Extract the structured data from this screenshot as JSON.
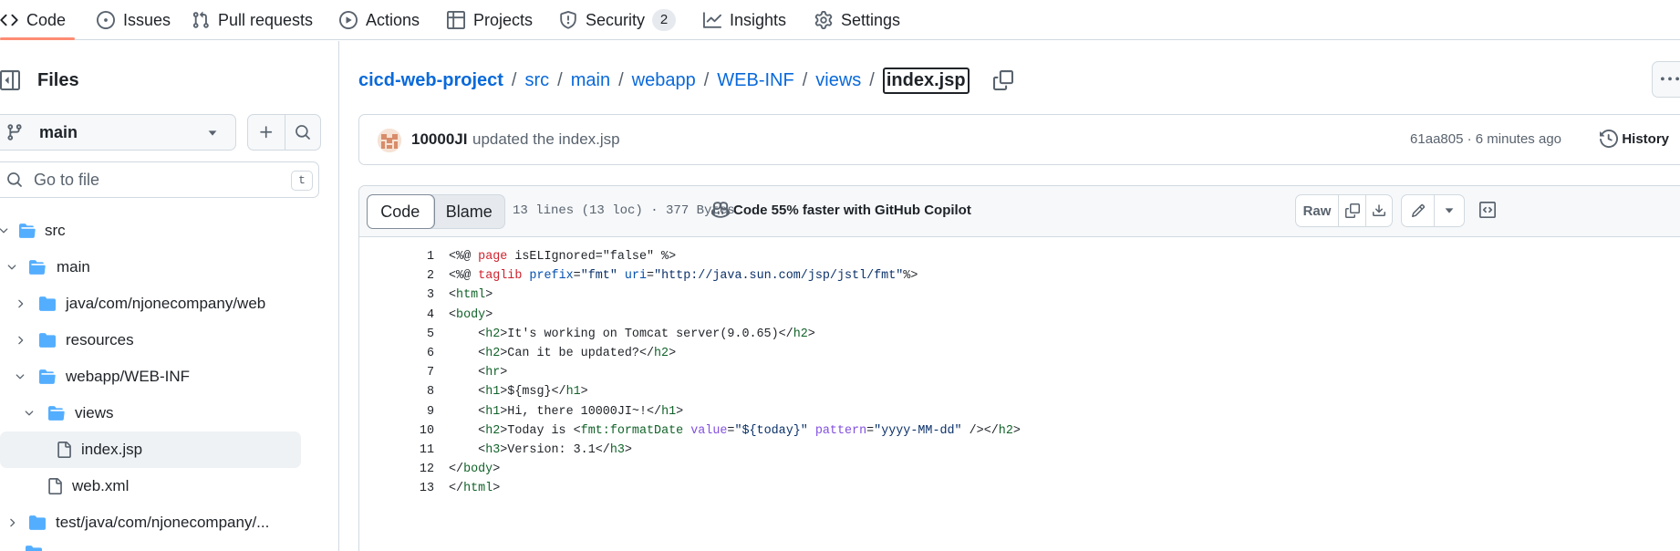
{
  "nav": {
    "tabs": [
      {
        "label": "Code"
      },
      {
        "label": "Issues"
      },
      {
        "label": "Pull requests"
      },
      {
        "label": "Actions"
      },
      {
        "label": "Projects"
      },
      {
        "label": "Security",
        "count": "2"
      },
      {
        "label": "Insights"
      },
      {
        "label": "Settings"
      }
    ]
  },
  "sidebar": {
    "title": "Files",
    "branch": "main",
    "search_placeholder": "Go to file",
    "search_shortcut": "t",
    "tree": [
      {
        "label": "src",
        "type": "folder",
        "expanded": true
      },
      {
        "label": "main",
        "type": "folder",
        "expanded": true
      },
      {
        "label": "java/com/njonecompany/web",
        "type": "folder",
        "expanded": false
      },
      {
        "label": "resources",
        "type": "folder",
        "expanded": false
      },
      {
        "label": "webapp/WEB-INF",
        "type": "folder",
        "expanded": true
      },
      {
        "label": "views",
        "type": "folder",
        "expanded": true
      },
      {
        "label": "index.jsp",
        "type": "file",
        "selected": true
      },
      {
        "label": "web.xml",
        "type": "file"
      },
      {
        "label": "test/java/com/njonecompany/...",
        "type": "folder",
        "expanded": false
      }
    ]
  },
  "breadcrumb": {
    "repo": "cicd-web-project",
    "parts": [
      "src",
      "main",
      "webapp",
      "WEB-INF",
      "views"
    ],
    "separator": "/",
    "current": "index.jsp"
  },
  "commit": {
    "author": "10000JI",
    "message": "updated the index.jsp",
    "meta": "61aa805 · 6 minutes ago",
    "history_label": "History"
  },
  "codeview": {
    "tab_code": "Code",
    "tab_blame": "Blame",
    "file_info": "13 lines (13 loc) · 377 Bytes",
    "copilot_text": "Code 55% faster with GitHub Copilot",
    "raw_label": "Raw",
    "line_numbers": [
      "1",
      "2",
      "3",
      "4",
      "5",
      "6",
      "7",
      "8",
      "9",
      "10",
      "11",
      "12",
      "13"
    ],
    "code": [
      [
        [
          "<%@ ",
          "p"
        ],
        [
          "page",
          "k"
        ],
        [
          " isELIgnored=\"false\" %>",
          "p"
        ]
      ],
      [
        [
          "<%@ ",
          "p"
        ],
        [
          "taglib",
          "k"
        ],
        [
          " ",
          "p"
        ],
        [
          "prefix",
          "a"
        ],
        [
          "=",
          "p"
        ],
        [
          "\"fmt\"",
          "s"
        ],
        [
          " ",
          "p"
        ],
        [
          "uri",
          "a"
        ],
        [
          "=",
          "p"
        ],
        [
          "\"http://java.sun.com/jsp/jstl/fmt\"",
          "s"
        ],
        [
          "%>",
          "p"
        ]
      ],
      [
        [
          "<",
          "p"
        ],
        [
          "html",
          "t"
        ],
        [
          ">",
          "p"
        ]
      ],
      [
        [
          "<",
          "p"
        ],
        [
          "body",
          "t"
        ],
        [
          ">",
          "p"
        ]
      ],
      [
        [
          "    <",
          "p"
        ],
        [
          "h2",
          "t"
        ],
        [
          ">It's working on Tomcat server(9.0.65)</",
          "p"
        ],
        [
          "h2",
          "t"
        ],
        [
          ">",
          "p"
        ]
      ],
      [
        [
          "    <",
          "p"
        ],
        [
          "h2",
          "t"
        ],
        [
          ">Can it be updated?</",
          "p"
        ],
        [
          "h2",
          "t"
        ],
        [
          ">",
          "p"
        ]
      ],
      [
        [
          "    <",
          "p"
        ],
        [
          "hr",
          "t"
        ],
        [
          ">",
          "p"
        ]
      ],
      [
        [
          "    <",
          "p"
        ],
        [
          "h1",
          "t"
        ],
        [
          ">${msg}</",
          "p"
        ],
        [
          "h1",
          "t"
        ],
        [
          ">",
          "p"
        ]
      ],
      [
        [
          "    <",
          "p"
        ],
        [
          "h1",
          "t"
        ],
        [
          ">Hi, there 10000JI~!</",
          "p"
        ],
        [
          "h1",
          "t"
        ],
        [
          ">",
          "p"
        ]
      ],
      [
        [
          "    <",
          "p"
        ],
        [
          "h2",
          "t"
        ],
        [
          ">Today is <",
          "p"
        ],
        [
          "fmt:formatDate",
          "t"
        ],
        [
          " ",
          "p"
        ],
        [
          "value",
          "at"
        ],
        [
          "=",
          "p"
        ],
        [
          "\"${today}\"",
          "s"
        ],
        [
          " ",
          "p"
        ],
        [
          "pattern",
          "at"
        ],
        [
          "=",
          "p"
        ],
        [
          "\"yyyy-MM-dd\"",
          "s"
        ],
        [
          " /></",
          "p"
        ],
        [
          "h2",
          "t"
        ],
        [
          ">",
          "p"
        ]
      ],
      [
        [
          "    <",
          "p"
        ],
        [
          "h3",
          "t"
        ],
        [
          ">Version: 3.1</",
          "p"
        ],
        [
          "h3",
          "t"
        ],
        [
          ">",
          "p"
        ]
      ],
      [
        [
          "</",
          "p"
        ],
        [
          "body",
          "t"
        ],
        [
          ">",
          "p"
        ]
      ],
      [
        [
          "</",
          "p"
        ],
        [
          "html",
          "t"
        ],
        [
          ">",
          "p"
        ]
      ]
    ]
  }
}
